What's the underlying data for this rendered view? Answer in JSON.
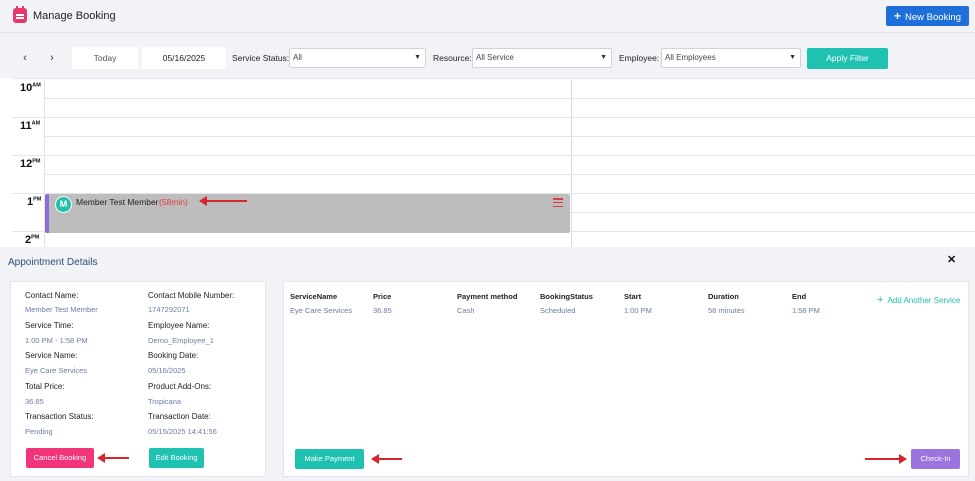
{
  "header": {
    "title": "Manage Booking",
    "new_booking_label": "New Booking",
    "new_booking_icon": "plus-icon"
  },
  "filters": {
    "prev_icon": "‹",
    "next_icon": "›",
    "today_label": "Today",
    "date_value": "05/16/2025",
    "service_status_label": "Service Status:",
    "service_status_value": "All",
    "resource_label": "Resource:",
    "resource_value": "All Service",
    "employee_label": "Employee:",
    "employee_value": "All Employees",
    "apply_label": "Apply Filter"
  },
  "calendar": {
    "hours": [
      {
        "num": "10",
        "ampm": "AM"
      },
      {
        "num": "11",
        "ampm": "AM"
      },
      {
        "num": "12",
        "ampm": "PM"
      },
      {
        "num": "1",
        "ampm": "PM"
      },
      {
        "num": "2",
        "ampm": "PM"
      }
    ],
    "event": {
      "avatar_letter": "M",
      "name": "Member Test Member",
      "duration": "(58min)",
      "color": "#8e6bd6"
    }
  },
  "details": {
    "title": "Appointment Details",
    "close_icon": "✕",
    "left": {
      "contact_name_label": "Contact Name:",
      "contact_name": "Member Test Member",
      "contact_mobile_label": "Contact Mobile Number:",
      "contact_mobile": "1747292071",
      "service_time_label": "Service Time:",
      "service_time": "1:00 PM - 1:58 PM",
      "employee_name_label": "Employee Name:",
      "employee_name": "Demo_Employee_1",
      "service_name_label": "Service Name:",
      "service_name": "Eye Care Services",
      "booking_date_label": "Booking Date:",
      "booking_date": "05/16/2025",
      "total_price_label": "Total Price:",
      "total_price": "36.85",
      "product_addons_label": "Product Add-Ons:",
      "product_addons": "Tropicana",
      "transaction_status_label": "Transaction Status:",
      "transaction_status": "Pending",
      "transaction_date_label": "Transaction Date:",
      "transaction_date": "05/15/2025 14:41:56",
      "cancel_label": "Cancel Booking",
      "edit_label": "Edit Booking"
    },
    "right": {
      "columns": [
        "ServiceName",
        "Price",
        "Payment method",
        "BookingStatus",
        "Start",
        "Duration",
        "End"
      ],
      "row": [
        "Eye Care Services",
        "36.85",
        "Cash",
        "Scheduled",
        "1:00 PM",
        "58 minutes",
        "1:58 PM"
      ],
      "add_service_label": "Add Another Service",
      "make_payment_label": "Make Payment",
      "check_in_label": "Check-In"
    }
  },
  "colors": {
    "primary_blue": "#1e6fd9",
    "teal": "#1fc2b1",
    "pink": "#f0357a",
    "purple": "#9b75dd",
    "annotation_red": "#d8242c"
  }
}
